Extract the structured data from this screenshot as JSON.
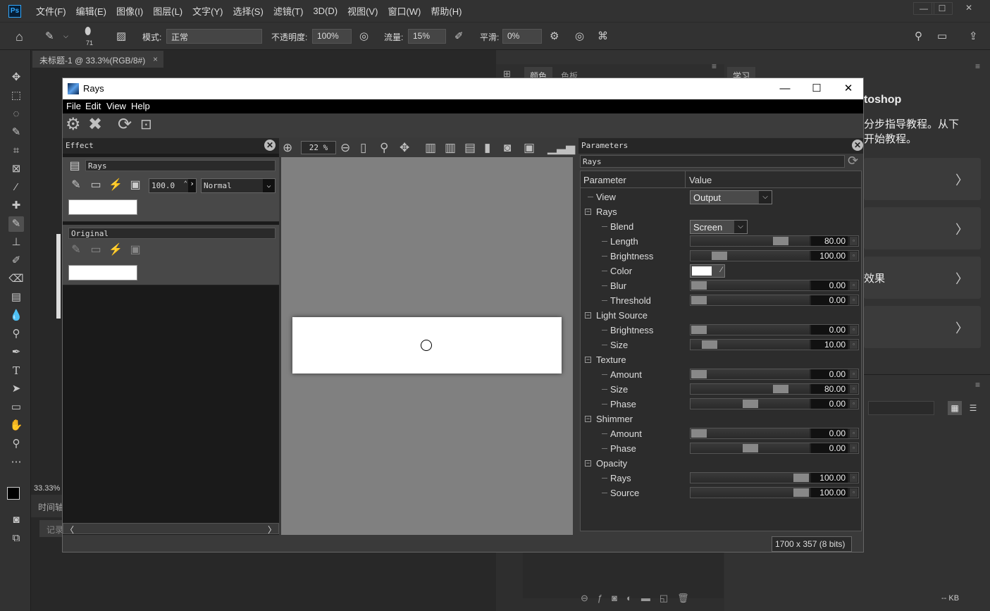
{
  "photoshop": {
    "menu": [
      "文件(F)",
      "编辑(E)",
      "图像(I)",
      "图层(L)",
      "文字(Y)",
      "选择(S)",
      "滤镜(T)",
      "3D(D)",
      "视图(V)",
      "窗口(W)",
      "帮助(H)"
    ],
    "options": {
      "brush_size": "71",
      "mode_label": "模式:",
      "mode_value": "正常",
      "opacity_label": "不透明度:",
      "opacity_value": "100%",
      "flow_label": "流量:",
      "flow_value": "15%",
      "smooth_label": "平滑:",
      "smooth_value": "0%"
    },
    "doc_tab": "未标题-1 @ 33.3%(RGB/8#)",
    "zoom": "33.33%",
    "timeline_label": "时间轴",
    "record_label": "记录",
    "panel_tabs": [
      "颜色",
      "色板"
    ],
    "learn_tab": "学习",
    "learn_title": "toshop",
    "learn_text_1": "分步指导教程。从下",
    "learn_text_2": "开始教程。",
    "learn_card_text": "效果",
    "kb_label": "-- KB"
  },
  "rays": {
    "title": "Rays",
    "menu": [
      "File",
      "Edit",
      "View",
      "Help"
    ],
    "effect_panel": {
      "title": "Effect",
      "layer_name": "Rays",
      "amount": "100.0",
      "blend_mode": "Normal",
      "original_name": "Original"
    },
    "preview": {
      "zoom": "22 %"
    },
    "parameters": {
      "title": "Parameters",
      "preset": "Rays",
      "col_param": "Parameter",
      "col_value": "Value",
      "rows": [
        {
          "label": "View",
          "type": "combo",
          "value": "Output",
          "level": 1
        },
        {
          "label": "Rays",
          "type": "group"
        },
        {
          "label": "Blend",
          "type": "combo",
          "value": "Screen",
          "level": 2
        },
        {
          "label": "Length",
          "type": "slider",
          "value": "80.00",
          "fraction": 0.8,
          "level": 2
        },
        {
          "label": "Brightness",
          "type": "slider",
          "value": "100.00",
          "fraction": 0.2,
          "level": 2
        },
        {
          "label": "Color",
          "type": "color",
          "value": "#ffffff",
          "level": 2
        },
        {
          "label": "Blur",
          "type": "slider",
          "value": "0.00",
          "fraction": 0.0,
          "level": 2
        },
        {
          "label": "Threshold",
          "type": "slider",
          "value": "0.00",
          "fraction": 0.0,
          "level": 2
        },
        {
          "label": "Light Source",
          "type": "group"
        },
        {
          "label": "Brightness",
          "type": "slider",
          "value": "0.00",
          "fraction": 0.0,
          "level": 2
        },
        {
          "label": "Size",
          "type": "slider",
          "value": "10.00",
          "fraction": 0.1,
          "level": 2
        },
        {
          "label": "Texture",
          "type": "group"
        },
        {
          "label": "Amount",
          "type": "slider",
          "value": "0.00",
          "fraction": 0.0,
          "level": 2
        },
        {
          "label": "Size",
          "type": "slider",
          "value": "80.00",
          "fraction": 0.8,
          "level": 2
        },
        {
          "label": "Phase",
          "type": "slider",
          "value": "0.00",
          "fraction": 0.5,
          "level": 2
        },
        {
          "label": "Shimmer",
          "type": "group"
        },
        {
          "label": "Amount",
          "type": "slider",
          "value": "0.00",
          "fraction": 0.0,
          "level": 2
        },
        {
          "label": "Phase",
          "type": "slider",
          "value": "0.00",
          "fraction": 0.5,
          "level": 2
        },
        {
          "label": "Opacity",
          "type": "group"
        },
        {
          "label": "Rays",
          "type": "slider",
          "value": "100.00",
          "fraction": 1.0,
          "level": 2
        },
        {
          "label": "Source",
          "type": "slider",
          "value": "100.00",
          "fraction": 1.0,
          "level": 2
        }
      ]
    },
    "status": "1700 x 357 (8 bits)"
  }
}
